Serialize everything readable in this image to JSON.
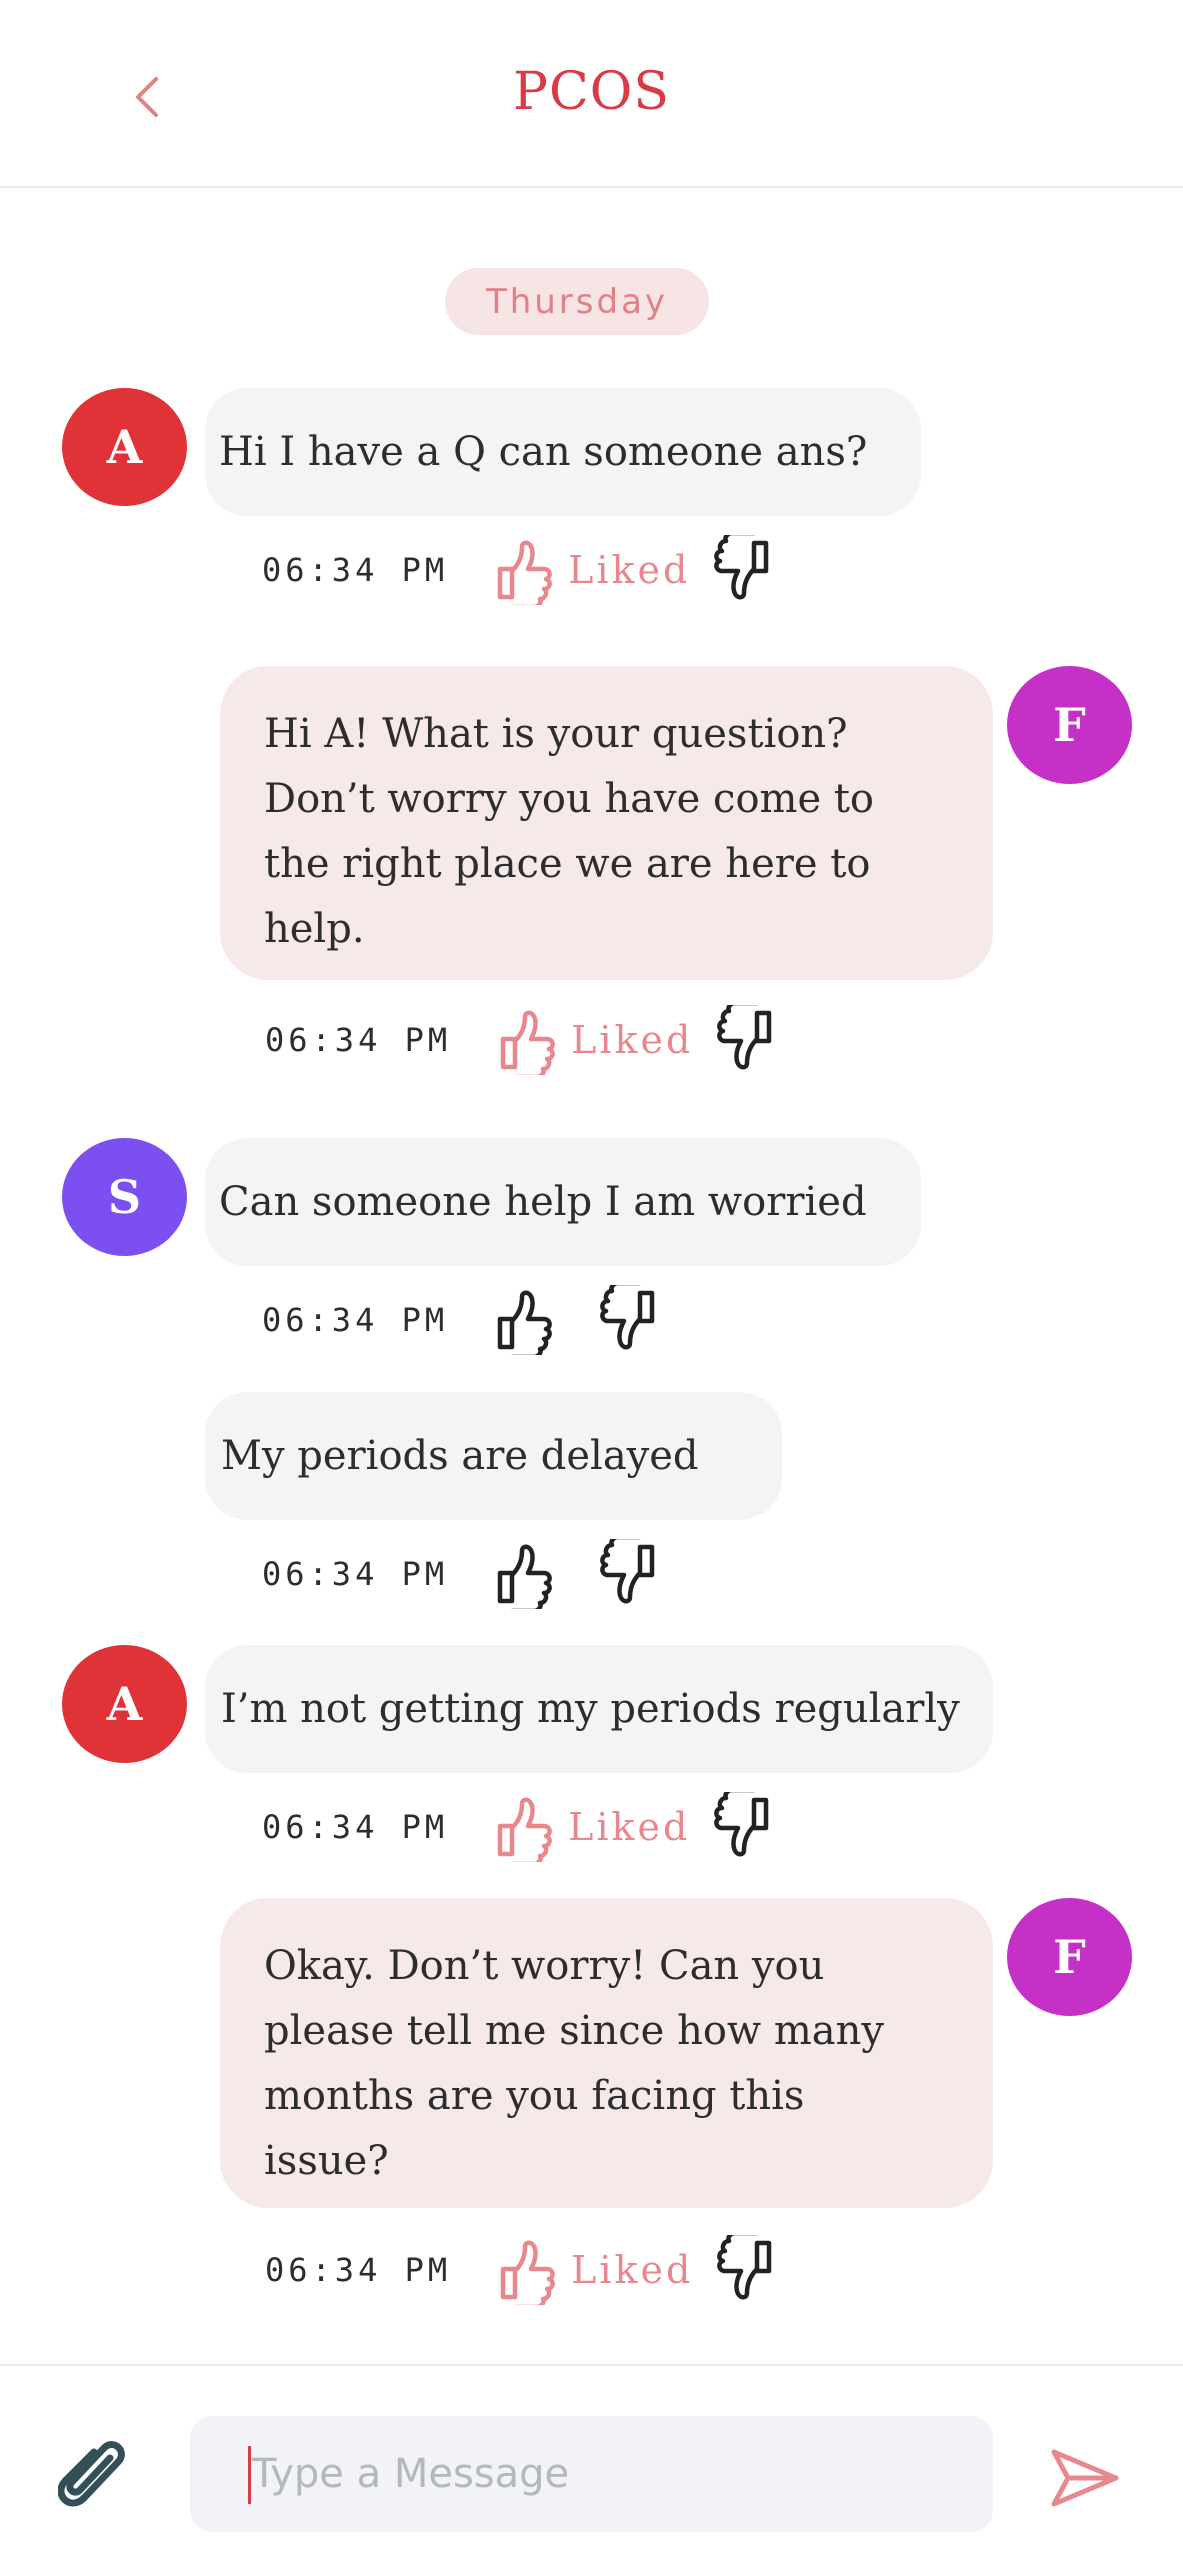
{
  "header": {
    "title": "PCOS",
    "back_icon": "chevron-left-icon"
  },
  "day_separator": "Thursday",
  "colors": {
    "accent": "#d83a46",
    "liked": "#e9878e",
    "avatar_A": "#e03338",
    "avatar_F": "#c531c6",
    "avatar_S": "#7c4ff0",
    "incoming_bubble": "#f4f4f4",
    "outgoing_bubble": "#f6e9e9"
  },
  "messages": [
    {
      "sender_initial": "A",
      "text": "Hi I have a Q can someone ans?",
      "time": "06:34 PM",
      "liked_label": "Liked"
    },
    {
      "sender_initial": "F",
      "text_lines": [
        "Hi A! What is your question?",
        "Don’t worry you have come to",
        "the right place we are here to",
        "help."
      ],
      "time": "06:34 PM",
      "liked_label": "Liked"
    },
    {
      "sender_initial": "S",
      "text": "Can someone help I am worried",
      "time": "06:34 PM"
    },
    {
      "text": "My periods are delayed",
      "time": "06:34 PM"
    },
    {
      "sender_initial": "A",
      "text": "I’m not getting my periods regularly",
      "time": "06:34 PM",
      "liked_label": "Liked"
    },
    {
      "sender_initial": "F",
      "text_lines": [
        "Okay. Don’t worry! Can you",
        "please tell me since how many",
        "months are you facing this",
        "issue?"
      ],
      "time": "06:34 PM",
      "liked_label": "Liked"
    }
  ],
  "composer": {
    "placeholder": "Type a Message",
    "value": "",
    "attach_icon": "paperclip-icon",
    "send_icon": "send-icon"
  }
}
